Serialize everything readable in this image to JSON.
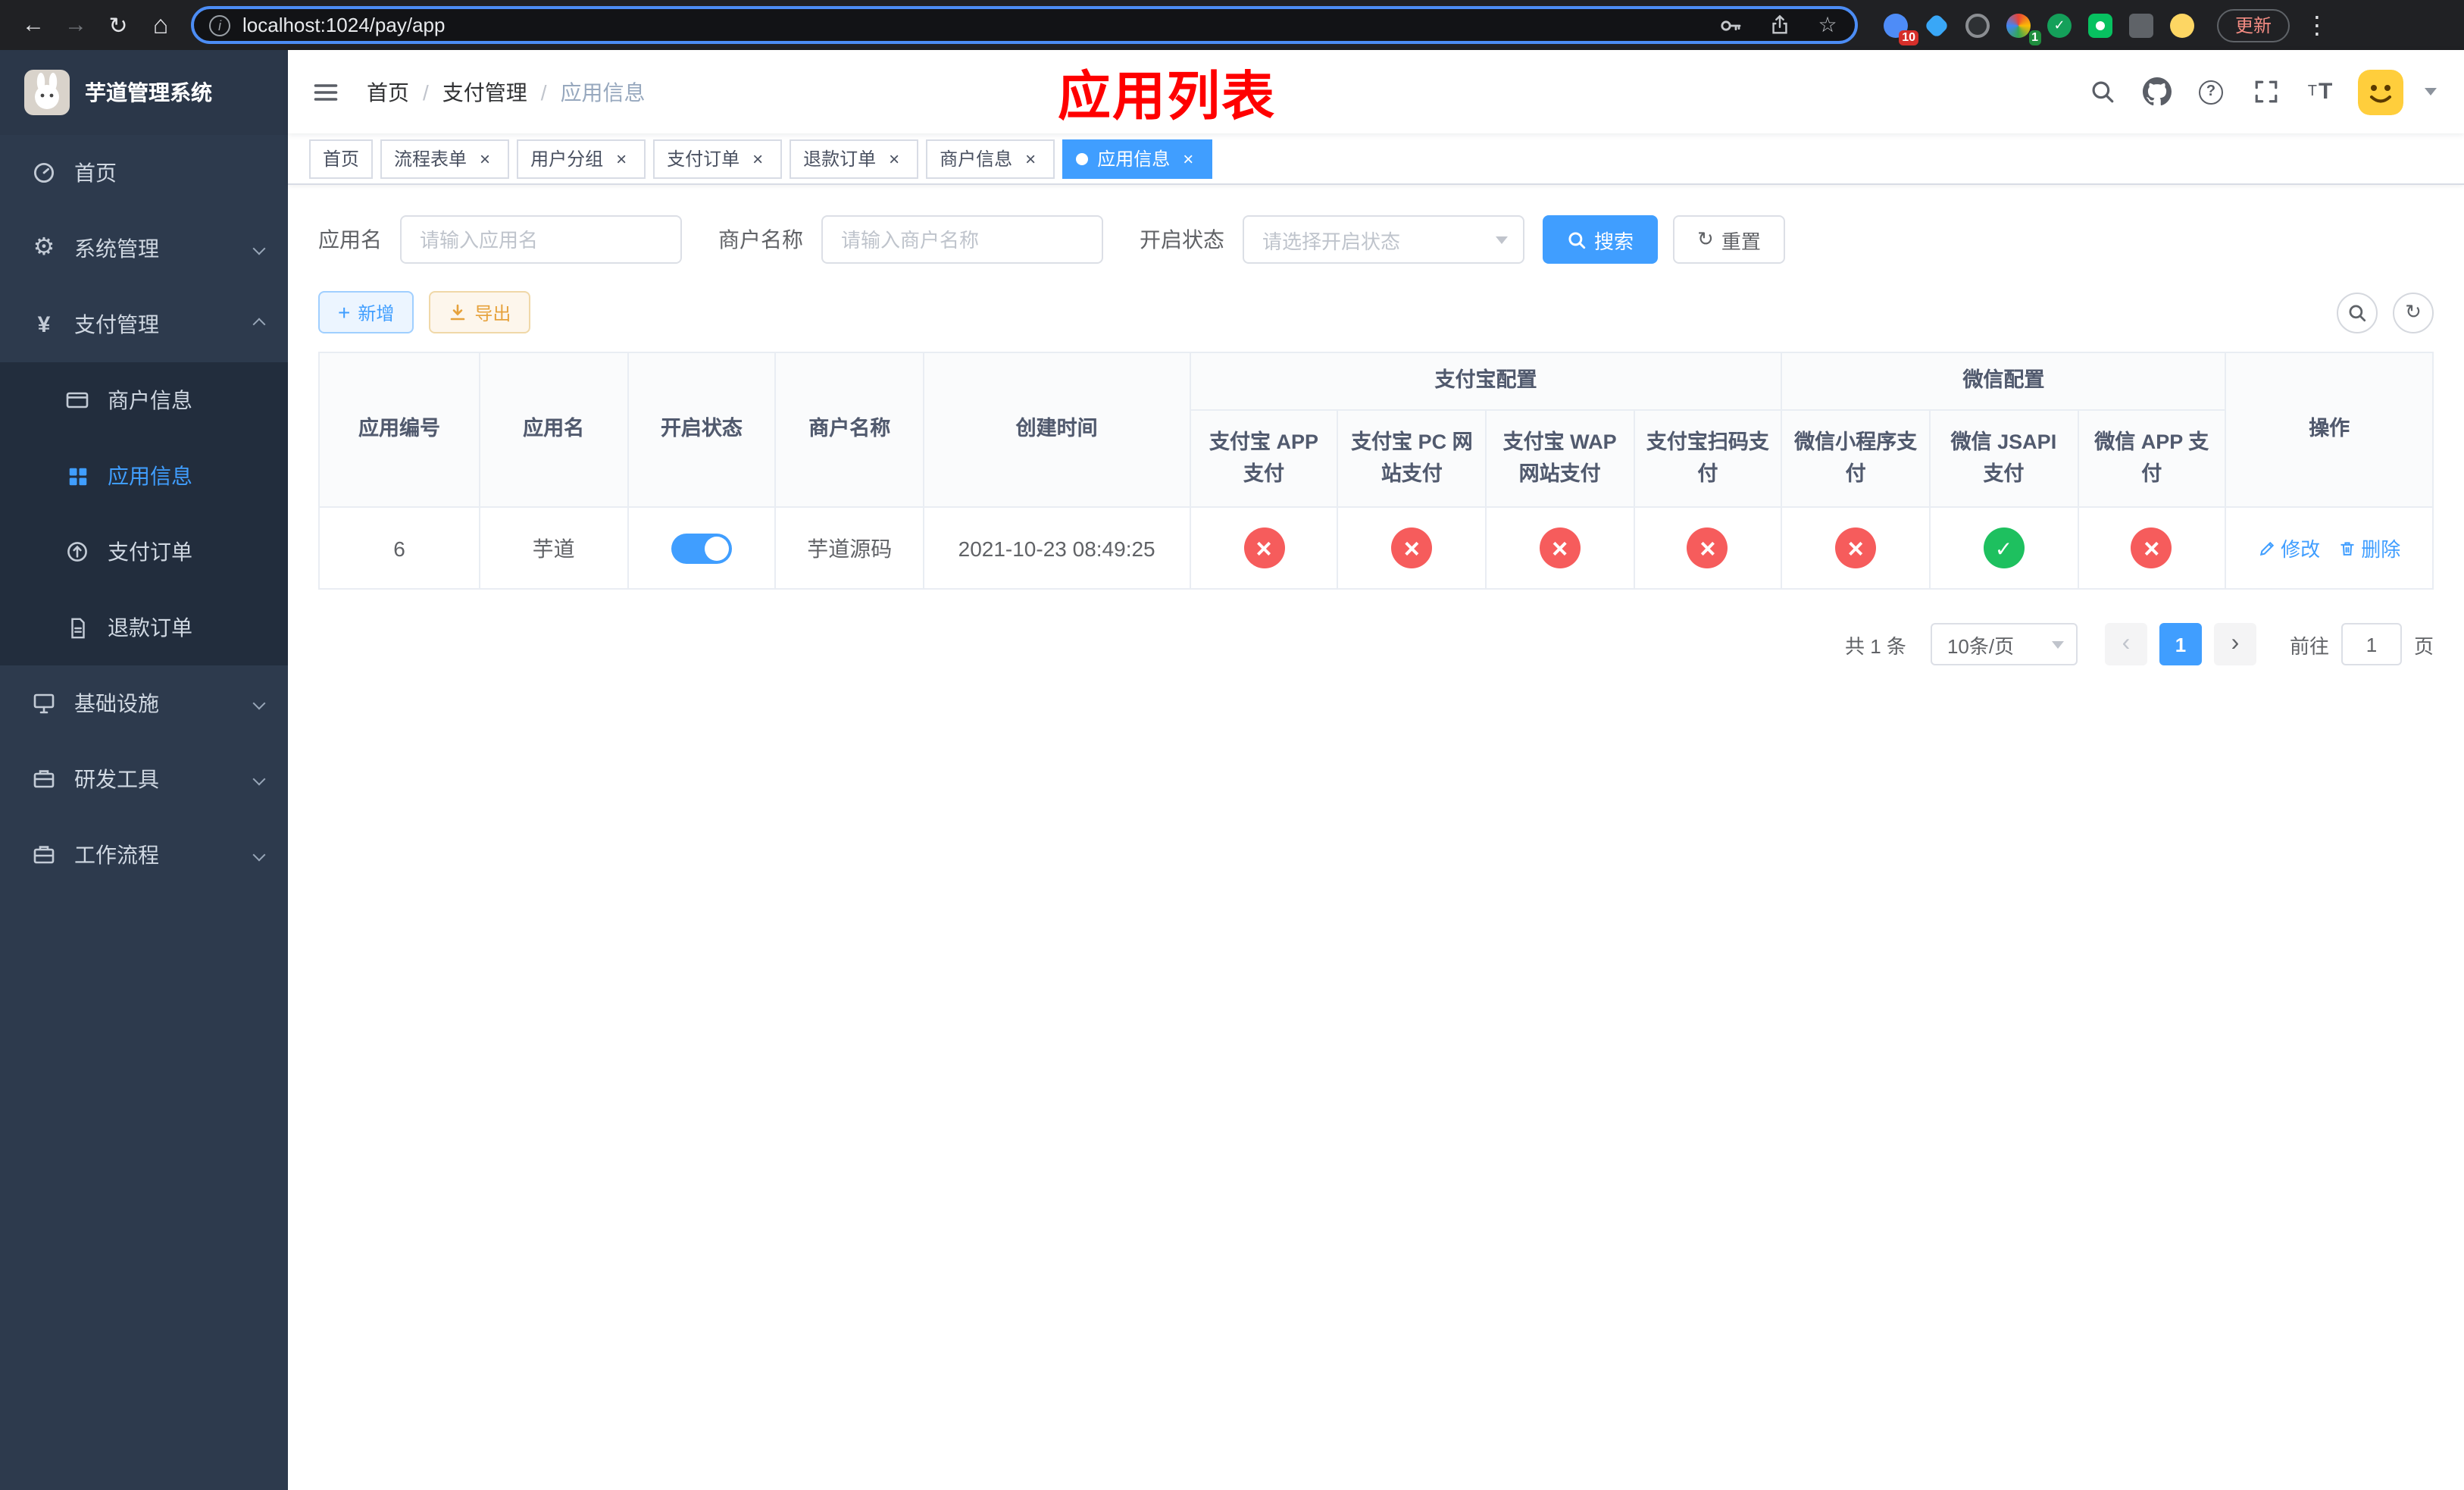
{
  "browser": {
    "url": "localhost:1024/pay/app",
    "update_label": "更新",
    "extensions": [
      {
        "badge": "10"
      },
      {},
      {},
      {
        "badge": "1"
      },
      {},
      {},
      {},
      {}
    ]
  },
  "sidebar": {
    "title": "芋道管理系统",
    "items": [
      {
        "label": "首页"
      },
      {
        "label": "系统管理"
      },
      {
        "label": "支付管理"
      },
      {
        "label": "商户信息"
      },
      {
        "label": "应用信息"
      },
      {
        "label": "支付订单"
      },
      {
        "label": "退款订单"
      },
      {
        "label": "基础设施"
      },
      {
        "label": "研发工具"
      },
      {
        "label": "工作流程"
      }
    ]
  },
  "navbar": {
    "breadcrumb": [
      "首页",
      "支付管理",
      "应用信息"
    ],
    "annotation": "应用列表"
  },
  "tabs": [
    {
      "label": "首页"
    },
    {
      "label": "流程表单"
    },
    {
      "label": "用户分组"
    },
    {
      "label": "支付订单"
    },
    {
      "label": "退款订单"
    },
    {
      "label": "商户信息"
    },
    {
      "label": "应用信息"
    }
  ],
  "filters": {
    "app_name_label": "应用名",
    "app_name_placeholder": "请输入应用名",
    "merchant_label": "商户名称",
    "merchant_placeholder": "请输入商户名称",
    "status_label": "开启状态",
    "status_placeholder": "请选择开启状态",
    "search_label": "搜索",
    "reset_label": "重置"
  },
  "actions": {
    "add_label": "新增",
    "export_label": "导出"
  },
  "table": {
    "cols": [
      "应用编号",
      "应用名",
      "开启状态",
      "商户名称",
      "创建时间",
      "操作"
    ],
    "group_alipay": "支付宝配置",
    "group_wechat": "微信配置",
    "alipay_cols": [
      "支付宝 APP 支付",
      "支付宝 PC 网站支付",
      "支付宝 WAP 网站支付",
      "支付宝扫码支付"
    ],
    "wechat_cols": [
      "微信小程序支付",
      "微信 JSAPI 支付",
      "微信 APP 支付"
    ],
    "rows": [
      {
        "id": "6",
        "name": "芋道",
        "enabled": "on",
        "merchant": "芋道源码",
        "created": "2021-10-23 08:49:25",
        "alipay_app": "off",
        "alipay_pc": "off",
        "alipay_wap": "off",
        "alipay_qr": "off",
        "wechat_mini": "off",
        "wechat_jsapi": "on",
        "wechat_app": "off",
        "edit_label": "修改",
        "delete_label": "删除"
      }
    ]
  },
  "pagination": {
    "total": "共 1 条",
    "page_size": "10条/页",
    "page": "1",
    "goto_label": "前往",
    "goto_value": "1",
    "page_unit": "页"
  },
  "colors": {
    "accent": "#409eff",
    "danger": "#f65c5c",
    "success": "#1ec05f",
    "annotation": "#ff0000",
    "sidebar_bg": "#2d3a4d"
  }
}
